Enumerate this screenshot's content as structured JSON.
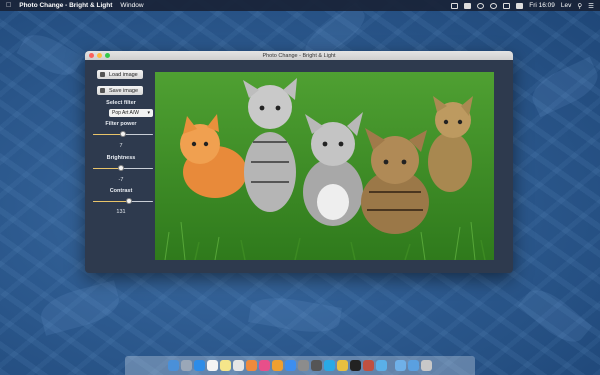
{
  "menubar": {
    "app_name": "Photo Change - Bright & Light",
    "menus": [
      "Window"
    ],
    "clock": "Fri 16:09",
    "user": "Lev",
    "status_icons": [
      "vpn-icon",
      "dropbox-icon",
      "time-machine-icon",
      "wifi-icon",
      "volume-icon",
      "battery-icon"
    ]
  },
  "window": {
    "title": "Photo Change - Bright & Light"
  },
  "sidebar": {
    "load_label": "Load image",
    "save_label": "Save image",
    "select_filter_label": "Select filter",
    "filter_value": "Pop Art A/W",
    "filter_power_label": "Filter power",
    "filter_power_value": "7",
    "filter_power_level": 0.5,
    "brightness_label": "Brightness",
    "brightness_value": "-7",
    "brightness_level": 0.47,
    "contrast_label": "Contrast",
    "contrast_value": "131",
    "contrast_level": 0.6
  },
  "photo": {
    "image_content": "five-kittens-on-grass"
  },
  "dock": {
    "apps": [
      "finder-icon",
      "launchpad-icon",
      "safari-icon",
      "calendar-icon",
      "notes-icon",
      "reminders-icon",
      "photos-icon",
      "itunes-icon",
      "ibooks-icon",
      "app-store-icon",
      "system-preferences-icon",
      "utility-icon",
      "skype-icon",
      "chrome-icon",
      "terminal-icon",
      "photo-change-icon",
      "preview-icon",
      "folder-icon",
      "downloads-icon",
      "trash-icon"
    ],
    "colors": [
      "#4a90d9",
      "#9aa7b8",
      "#2d8ce8",
      "#f4f4f4",
      "#f5e68a",
      "#e6e6e6",
      "#f08a3c",
      "#e84f8a",
      "#f0a030",
      "#3d8ef0",
      "#8c8c8c",
      "#555555",
      "#29a9e6",
      "#e8c040",
      "#222222",
      "#c05040",
      "#5ab0e8",
      "#6fb0e8",
      "#5aa0e0",
      "#c8c8c8"
    ]
  }
}
